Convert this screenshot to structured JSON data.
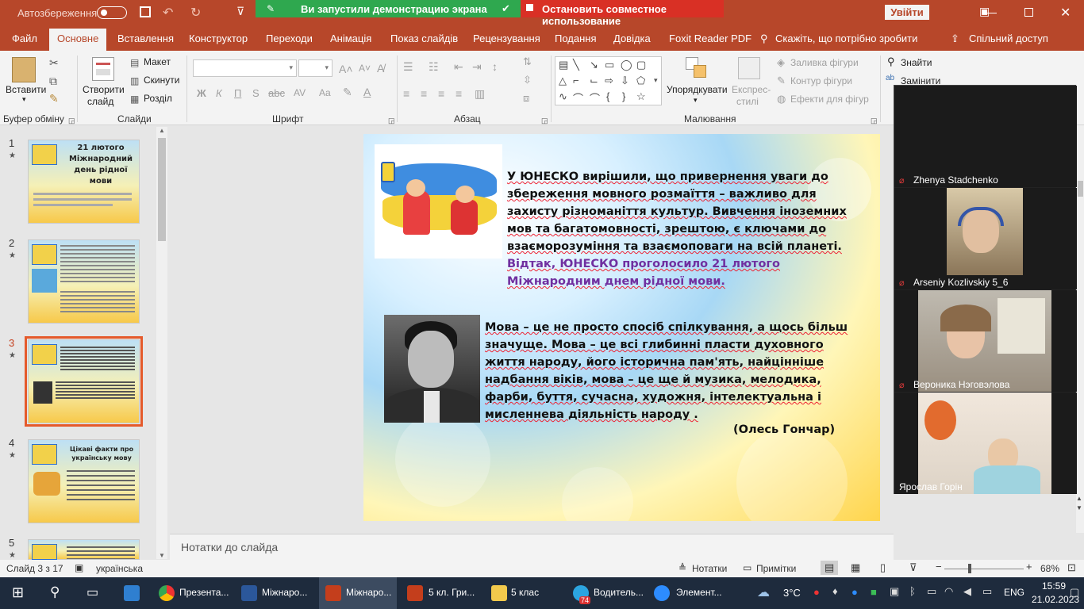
{
  "titlebar": {
    "autosave": "Автозбереження",
    "share_banner": "Ви запустили демонстрацию экрана",
    "stop_share": "Остановить совместное использование",
    "login": "Увійти"
  },
  "tabs": [
    "Файл",
    "Основне",
    "Вставлення",
    "Конструктор",
    "Переходи",
    "Анімація",
    "Показ слайдів",
    "Рецензування",
    "Подання",
    "Довідка",
    "Foxit Reader PDF"
  ],
  "tell_me": "Скажіть, що потрібно зробити",
  "share": "Спільний доступ",
  "ribbon": {
    "paste": "Вставити",
    "clipboard": "Буфер обміну",
    "new_slide_1": "Створити",
    "new_slide_2": "слайд",
    "layout": "Макет",
    "reset": "Скинути",
    "section": "Розділ",
    "slides": "Слайди",
    "font": "Шрифт",
    "paragraph": "Абзац",
    "arrange": "Упорядкувати",
    "quick_styles_1": "Експрес-",
    "quick_styles_2": "стилі",
    "shape_fill": "Заливка фігури",
    "shape_outline": "Контур фігури",
    "shape_effects": "Ефекти для фігур",
    "drawing": "Малювання",
    "find": "Знайти",
    "replace": "Замінити",
    "bold": "Ж",
    "italic": "К",
    "underline": "П",
    "strike": "S"
  },
  "thumbnails": [
    {
      "num": "1",
      "title": "21 лютого Міжнародний день рідної мови"
    },
    {
      "num": "2",
      "title": ""
    },
    {
      "num": "3",
      "title": ""
    },
    {
      "num": "4",
      "title": "Цікаві факти про українську мову"
    },
    {
      "num": "5",
      "title": ""
    }
  ],
  "slide": {
    "para1_black": "У ЮНЕСКО вирішили, що привернення уваги до збереження мовного розмаїття – важливо для захисту різноманіття культур. Вивчення іноземних мов та багатомовності, зрештою, є ключами до взаєморозуміння та взаємоповаги на всій планеті.",
    "para1_purple": "Відтак, ЮНЕСКО проголосило 21 лютого Міжнародним днем рідної мови.",
    "para2": "Мова – це не просто спосіб спілкування, а щось більш значуще. Мова – це всі глибинні пласти духовного життя народу, його історична пам'ять, найцінніше надбання віків, мова – це ще й музика, мелодика, фарби, буття, сучасна, художня, інтелектуальна і мисленнева діяльність народу .",
    "author": "(Олесь Гончар)"
  },
  "notes_placeholder": "Нотатки до слайда",
  "status": {
    "slide": "Слайд 3 з 17",
    "language": "українська",
    "notes": "Нотатки",
    "comments": "Примітки",
    "zoom": "68%"
  },
  "participants": [
    {
      "name": "Zhenya Stadchenko"
    },
    {
      "name": "Arseniy Kozlivskiy 5_6"
    },
    {
      "name": "Вероника Нэговэлова"
    },
    {
      "name": "Ярослав Горін"
    }
  ],
  "taskbar": {
    "items": [
      "Презента...",
      "Міжнаро...",
      "Міжнаро...",
      "5 кл. Гри...",
      "5 клас",
      "Водитель...",
      "Элемент..."
    ],
    "telegram_badge": "74",
    "weather": "3°C",
    "lang": "ENG",
    "time": "15:59",
    "date": "21.02.2023"
  },
  "colors": {
    "accent": "#b7472a",
    "purple": "#7030a0",
    "banner_green": "#2fa84f",
    "banner_red": "#d93025"
  }
}
